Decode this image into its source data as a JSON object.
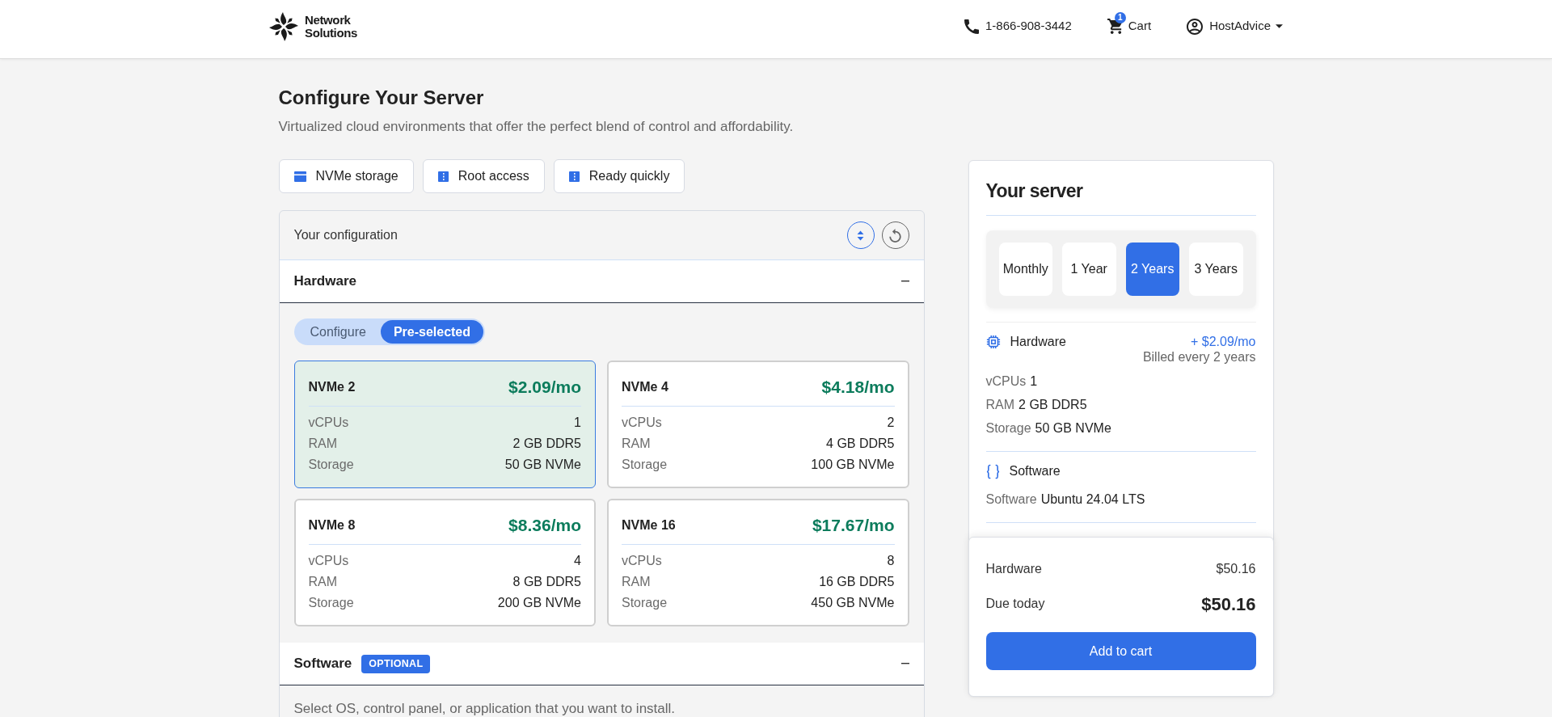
{
  "header": {
    "logo_text": "Network Solutions",
    "phone": "1-866-908-3442",
    "cart": {
      "label": "Cart",
      "count": "1"
    },
    "account": {
      "label": "HostAdvice"
    }
  },
  "intro": {
    "title": "Configure Your Server",
    "subtitle": "Virtualized cloud environments that offer the perfect blend of control and affordability."
  },
  "features": [
    {
      "kind": "drive",
      "label": "NVMe storage"
    },
    {
      "kind": "rack",
      "label": "Root access"
    },
    {
      "kind": "rack",
      "label": "Ready quickly"
    }
  ],
  "configuration": {
    "title": "Your configuration",
    "sections": [
      {
        "kind": "hardware",
        "title": "Hardware",
        "expanded": true,
        "modes": [
          {
            "label": "Configure",
            "selected": false
          },
          {
            "label": "Pre-selected",
            "selected": true
          }
        ],
        "plans": [
          {
            "name": "NVMe 2",
            "price": "$2.09/mo",
            "selected": true,
            "specs": [
              {
                "label": "vCPUs",
                "value": "1"
              },
              {
                "label": "RAM",
                "value": "2 GB DDR5"
              },
              {
                "label": "Storage",
                "value": "50 GB NVMe"
              }
            ]
          },
          {
            "name": "NVMe 4",
            "price": "$4.18/mo",
            "selected": false,
            "specs": [
              {
                "label": "vCPUs",
                "value": "2"
              },
              {
                "label": "RAM",
                "value": "4 GB DDR5"
              },
              {
                "label": "Storage",
                "value": "100 GB NVMe"
              }
            ]
          },
          {
            "name": "NVMe 8",
            "price": "$8.36/mo",
            "selected": false,
            "specs": [
              {
                "label": "vCPUs",
                "value": "4"
              },
              {
                "label": "RAM",
                "value": "8 GB DDR5"
              },
              {
                "label": "Storage",
                "value": "200 GB NVMe"
              }
            ]
          },
          {
            "name": "NVMe 16",
            "price": "$17.67/mo",
            "selected": false,
            "specs": [
              {
                "label": "vCPUs",
                "value": "8"
              },
              {
                "label": "RAM",
                "value": "16 GB DDR5"
              },
              {
                "label": "Storage",
                "value": "450 GB NVMe"
              }
            ]
          }
        ]
      },
      {
        "kind": "software",
        "title": "Software",
        "badge": "OPTIONAL",
        "expanded": true,
        "description": "Select OS, control panel, or application that you want to install."
      }
    ]
  },
  "summary": {
    "title": "Your server",
    "billing_periods": [
      {
        "label": "Monthly",
        "selected": false
      },
      {
        "label": "1 Year",
        "selected": false
      },
      {
        "label": "2 Years",
        "selected": true
      },
      {
        "label": "3 Years",
        "selected": false
      }
    ],
    "items": [
      {
        "kind": "hardware",
        "title": "Hardware",
        "price": "+ $2.09/mo",
        "note": "Billed every 2 years",
        "specs": [
          {
            "label": "vCPUs",
            "value": "1"
          },
          {
            "label": "RAM",
            "value": "2 GB DDR5"
          },
          {
            "label": "Storage",
            "value": "50 GB NVMe"
          }
        ]
      },
      {
        "kind": "software",
        "title": "Software",
        "specs": [
          {
            "label": "Software",
            "value": "Ubuntu 24.04 LTS"
          }
        ]
      }
    ]
  },
  "checkout": {
    "lines": [
      {
        "kind": "subtotal",
        "label": "Hardware",
        "value": "$50.16"
      },
      {
        "kind": "total",
        "label": "Due today",
        "value": "$50.16"
      }
    ],
    "button": "Add to cart"
  }
}
